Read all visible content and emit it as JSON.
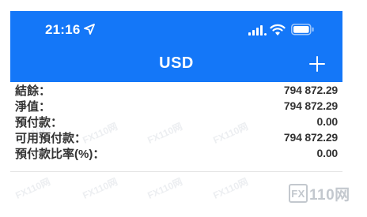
{
  "status_bar": {
    "time": "21:16"
  },
  "nav": {
    "title": "USD"
  },
  "account": {
    "rows": [
      {
        "label": "結餘：",
        "value": "794 872.29"
      },
      {
        "label": "淨值：",
        "value": "794 872.29"
      },
      {
        "label": "預付款：",
        "value": "0.00"
      },
      {
        "label": "可用預付款：",
        "value": "794 872.29"
      },
      {
        "label": "預付款比率(%)：",
        "value": "0.00"
      }
    ]
  },
  "watermark": {
    "tile_text": "FX110网",
    "logo_box": "FX",
    "logo_text": "110网"
  },
  "colors": {
    "header_blue": "#1477f8",
    "text_dark": "#333333"
  }
}
